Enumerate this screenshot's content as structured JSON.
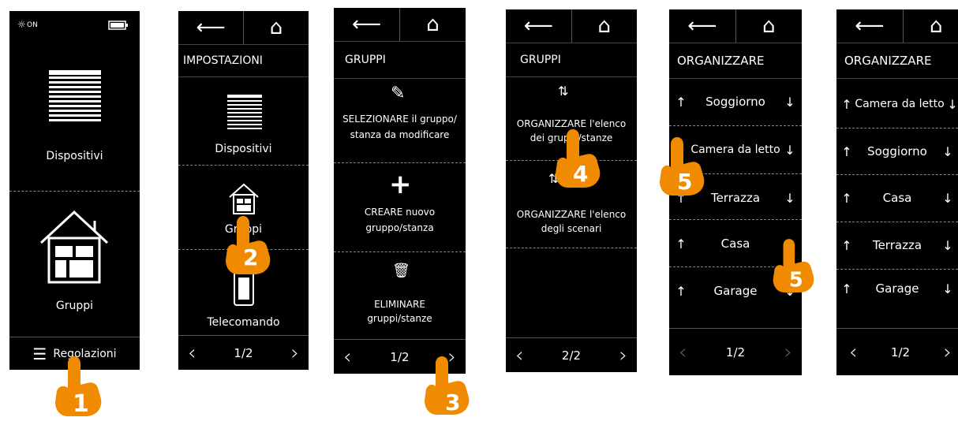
{
  "screen1": {
    "status_icon": "sun-on-icon",
    "status_text": "ON",
    "battery_icon": "battery-icon",
    "devices_label": "Dispositivi",
    "groups_label": "Gruppi",
    "settings_label": "Regolazioni"
  },
  "screen2": {
    "header": "IMPOSTAZIONI",
    "devices_label": "Dispositivi",
    "groups_label": "Gruppi",
    "remote_label": "Telecomando",
    "pager": "1/2"
  },
  "screen3": {
    "header": "GRUPPI",
    "select_text_1": "SELEZIONARE il gruppo/",
    "select_text_2": "stanza da modificare",
    "create_text_1": "CREARE nuovo",
    "create_text_2": "gruppo/stanza",
    "delete_text_1": "ELIMINARE",
    "delete_text_2": "gruppi/stanze",
    "pager": "1/2"
  },
  "screen4": {
    "header": "GRUPPI",
    "organize_groups_1": "ORGANIZZARE l'elenco",
    "organize_groups_2": "dei gruppi/stanze",
    "organize_scenes_1": "ORGANIZZARE l'elenco",
    "organize_scenes_2": "degli scenari",
    "pager": "2/2"
  },
  "screen5": {
    "header": "ORGANIZZARE",
    "rows": [
      "Soggiorno",
      "Camera da letto",
      "Terrazza",
      "Casa",
      "Garage"
    ],
    "pager": "1/2"
  },
  "screen6": {
    "header": "ORGANIZZARE",
    "rows": [
      "Camera da letto",
      "Soggiorno",
      "Casa",
      "Terrazza",
      "Garage"
    ],
    "pager": "1/2"
  },
  "steps": [
    "1",
    "2",
    "3",
    "4",
    "5",
    "5"
  ],
  "colors": {
    "accent": "#f08a00",
    "screen_bg": "#000000",
    "text": "#ffffff"
  }
}
